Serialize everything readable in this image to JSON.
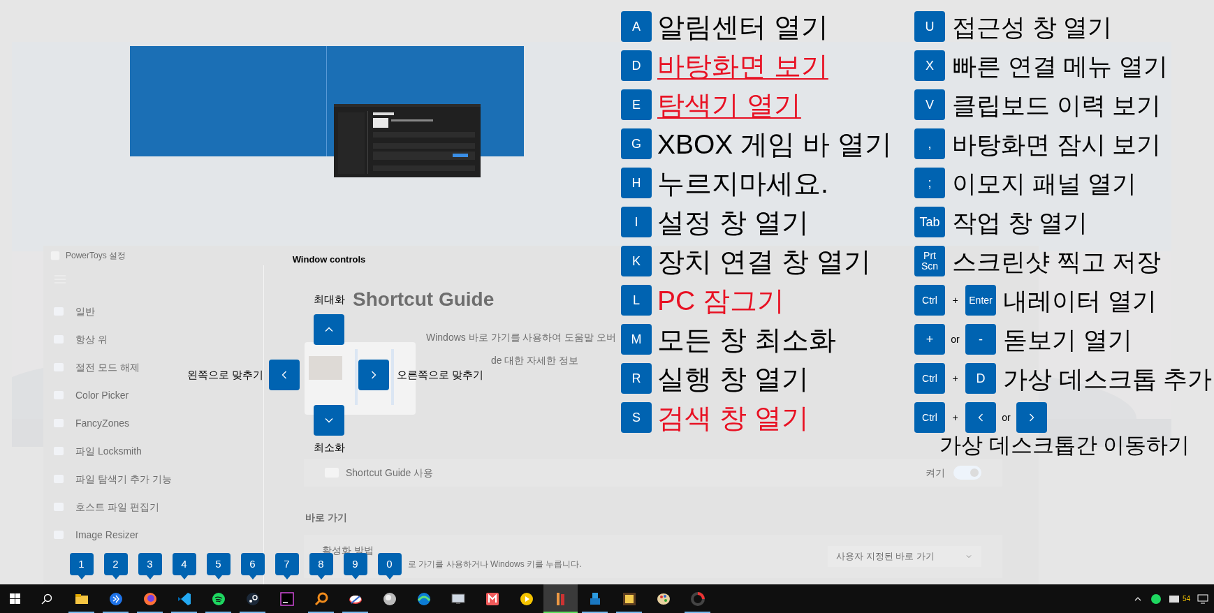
{
  "settings_window": {
    "title": "PowerToys 설정",
    "nav": [
      {
        "label": "일반"
      },
      {
        "label": "항상 위"
      },
      {
        "label": "절전 모드 해제"
      },
      {
        "label": "Color Picker"
      },
      {
        "label": "FancyZones"
      },
      {
        "label": "파일 Locksmith"
      },
      {
        "label": "파일 탐색기 추가 기능"
      },
      {
        "label": "호스트 파일 편집기"
      },
      {
        "label": "Image Resizer"
      }
    ],
    "page_title": "Shortcut Guide",
    "description": "Windows 바로 가기를 사용하여 도움말 오버",
    "link": "de 대한 자세한 정보",
    "enable_card": {
      "label": "Shortcut Guide 사용",
      "toggle_label": "켜기",
      "on": true
    },
    "section_title": "바로 가기",
    "activation_card": {
      "title": "활성화 방법",
      "description": "로 가기를 사용하거나 Windows 키를 누릅니다.",
      "dropdown_value": "사용자 지정된 바로 가기"
    }
  },
  "window_controls": {
    "title": "Window controls",
    "maximize": "최대화",
    "snap_left": "왼쪽으로 맞추기",
    "snap_right": "오른쪽으로 맞추기",
    "minimize": "최소화"
  },
  "shortcuts_left": [
    {
      "key": "A",
      "label": "알림센터 열기",
      "color": "#000000",
      "underlined": false
    },
    {
      "key": "D",
      "label": "바탕화면 보기",
      "color": "#e81123",
      "underlined": true
    },
    {
      "key": "E",
      "label": "탐색기 열기",
      "color": "#e81123",
      "underlined": true
    },
    {
      "key": "G",
      "label": "XBOX 게임 바 열기",
      "color": "#000000",
      "underlined": false
    },
    {
      "key": "H",
      "label": "누르지마세요.",
      "color": "#000000",
      "underlined": false
    },
    {
      "key": "I",
      "label": "설정 창 열기",
      "color": "#000000",
      "underlined": false
    },
    {
      "key": "K",
      "label": "장치 연결 창 열기",
      "color": "#000000",
      "underlined": false
    },
    {
      "key": "L",
      "label": "PC 잠그기",
      "color": "#e81123",
      "underlined": false
    },
    {
      "key": "M",
      "label": "모든 창 최소화",
      "color": "#000000",
      "underlined": false
    },
    {
      "key": "R",
      "label": "실행 창 열기",
      "color": "#000000",
      "underlined": false
    },
    {
      "key": "S",
      "label": "검색 창 열기",
      "color": "#e81123",
      "underlined": false
    }
  ],
  "shortcuts_right": [
    {
      "keys": [
        {
          "kind": "key",
          "text": "U"
        }
      ],
      "label": "접근성 창 열기",
      "label_below": false
    },
    {
      "keys": [
        {
          "kind": "key",
          "text": "X"
        }
      ],
      "label": "빠른 연결 메뉴 열기",
      "label_below": false
    },
    {
      "keys": [
        {
          "kind": "key",
          "text": "V"
        }
      ],
      "label": "클립보드 이력 보기",
      "label_below": false
    },
    {
      "keys": [
        {
          "kind": "key",
          "text": ","
        }
      ],
      "label": "바탕화면 잠시 보기",
      "label_below": false
    },
    {
      "keys": [
        {
          "kind": "key",
          "text": ";"
        }
      ],
      "label": "이모지 패널 열기",
      "label_below": false
    },
    {
      "keys": [
        {
          "kind": "key",
          "text": "Tab"
        }
      ],
      "label": "작업 창 열기",
      "label_below": false
    },
    {
      "keys": [
        {
          "kind": "key",
          "text": "Prt Scn"
        }
      ],
      "label": "스크린샷 찍고 저장",
      "label_below": false
    },
    {
      "keys": [
        {
          "kind": "key",
          "text": "Ctrl"
        },
        {
          "kind": "joiner",
          "text": "+"
        },
        {
          "kind": "key",
          "text": "Enter"
        }
      ],
      "label": "내레이터 열기",
      "label_below": false
    },
    {
      "keys": [
        {
          "kind": "key",
          "text": "+"
        },
        {
          "kind": "joiner",
          "text": "or"
        },
        {
          "kind": "key",
          "text": "-"
        }
      ],
      "label": "돋보기 열기",
      "label_below": false
    },
    {
      "keys": [
        {
          "kind": "key",
          "text": "Ctrl"
        },
        {
          "kind": "joiner",
          "text": "+"
        },
        {
          "kind": "key",
          "text": "D"
        }
      ],
      "label": "가상 데스크톱 추가",
      "label_below": false
    },
    {
      "keys": [
        {
          "kind": "key",
          "text": "Ctrl"
        },
        {
          "kind": "joiner",
          "text": "+"
        },
        {
          "kind": "arrow_left"
        },
        {
          "kind": "joiner",
          "text": "or"
        },
        {
          "kind": "arrow_right"
        }
      ],
      "label": "가상 데스크톱간 이동하기",
      "label_below": true
    }
  ],
  "taskbar": {
    "number_badges": [
      "1",
      "2",
      "3",
      "4",
      "5",
      "6",
      "7",
      "8",
      "9",
      "0"
    ],
    "apps": [
      {
        "running": true,
        "active": false
      },
      {
        "running": true,
        "active": false
      },
      {
        "running": true,
        "active": false
      },
      {
        "running": true,
        "active": false
      },
      {
        "running": true,
        "active": false
      },
      {
        "running": true,
        "active": false
      },
      {
        "running": false,
        "active": false
      },
      {
        "running": true,
        "active": false
      },
      {
        "running": true,
        "active": false
      },
      {
        "running": false,
        "active": false
      },
      {
        "running": false,
        "active": false
      },
      {
        "running": false,
        "active": false
      },
      {
        "running": false,
        "active": false
      },
      {
        "running": false,
        "active": false
      },
      {
        "running": true,
        "active": true
      },
      {
        "running": true,
        "active": false
      },
      {
        "running": true,
        "active": false
      },
      {
        "running": false,
        "active": false
      },
      {
        "running": true,
        "active": false
      }
    ],
    "tray_battery": "54"
  }
}
